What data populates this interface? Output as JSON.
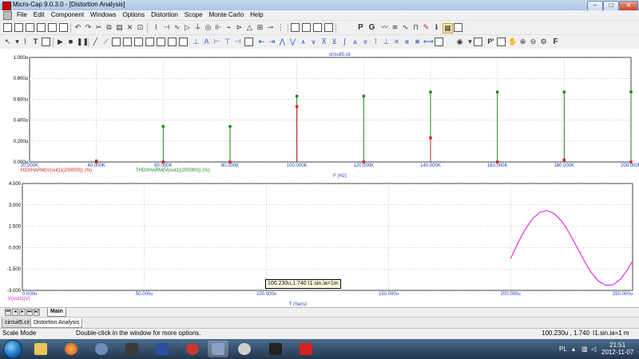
{
  "window": {
    "title": "Micro-Cap 9.0.3.0 - [Distortion Analysis]",
    "minimize": "–",
    "maximize": "□",
    "close": "✕"
  },
  "menu": [
    "File",
    "Edit",
    "Component",
    "Windows",
    "Options",
    "Distortion",
    "Scope",
    "Monte Carlo",
    "Help"
  ],
  "toolbar_text": {
    "p": "P",
    "g": "G",
    "t": "T",
    "f": "F"
  },
  "chart_data": [
    {
      "type": "scatter",
      "title": "circuit5.cir",
      "xlabel": "F (Hz)",
      "x_ticks": [
        "20.000K",
        "40.000K",
        "60.000K",
        "80.000K",
        "100.000K",
        "120.000K",
        "140.000K",
        "160.000K",
        "180.000K",
        "200.000K"
      ],
      "y_ticks": [
        "1.000u",
        "0.800u",
        "0.600u",
        "0.400u",
        "0.200u",
        "0.000u"
      ],
      "xlim": [
        20000,
        200000
      ],
      "ylim": [
        0,
        1.0
      ],
      "grid": true,
      "series": [
        {
          "name": "HDXHARM(V(out1)(200000)) (%)",
          "color": "#d42020",
          "x": [
            40000,
            60000,
            80000,
            100000,
            120000,
            140000,
            160000,
            180000,
            200000
          ],
          "values": [
            0.0,
            0.0,
            0.0,
            0.53,
            0.0,
            0.23,
            0.0,
            0.02,
            0.0
          ]
        },
        {
          "name": "THDXHARM(V(out1)(200000)) (%)",
          "color": "#1a8a1a",
          "x": [
            40000,
            60000,
            80000,
            100000,
            120000,
            140000,
            160000,
            180000,
            200000
          ],
          "values": [
            0.01,
            0.34,
            0.34,
            0.63,
            0.63,
            0.67,
            0.67,
            0.67,
            0.67
          ]
        }
      ]
    },
    {
      "type": "line",
      "xlabel": "T (Secs)",
      "x_ticks": [
        "0.000u",
        "50.000u",
        "100.000u",
        "150.000u",
        "200.000u",
        "250.000u"
      ],
      "y_ticks": [
        "4.500",
        "3.000",
        "1.500",
        "0.000",
        "-1.500",
        "-3.000"
      ],
      "xlim": [
        0,
        250
      ],
      "ylim": [
        -3.0,
        4.5
      ],
      "grid": true,
      "series": [
        {
          "name": "V(out1)(V)",
          "color": "#e020e0",
          "x": [
            200,
            203,
            206,
            209,
            212,
            215,
            218,
            221,
            224,
            227,
            230,
            233,
            236,
            239,
            242,
            245,
            248,
            250
          ],
          "values": [
            -0.78,
            0.33,
            1.29,
            2.03,
            2.48,
            2.6,
            2.37,
            1.84,
            1.05,
            0.1,
            -0.87,
            -1.73,
            -2.35,
            -2.65,
            -2.61,
            -2.22,
            -1.52,
            -0.95
          ]
        }
      ]
    }
  ],
  "tooltip": "100.230u,1.740 I1.sin.ia=1m",
  "nav": {
    "tab": "Main"
  },
  "doc_tabs": [
    "circuit5.cir",
    "Distortion Analysis"
  ],
  "status": {
    "mode": "Scale Mode",
    "hint": "Double-click in the window for more options.",
    "cursor": "100.230u , 1.740",
    "param": "I1.sin.ia=1 m"
  },
  "tray": {
    "lang": "PL",
    "time": "21:51",
    "date": "2012-11-07"
  }
}
